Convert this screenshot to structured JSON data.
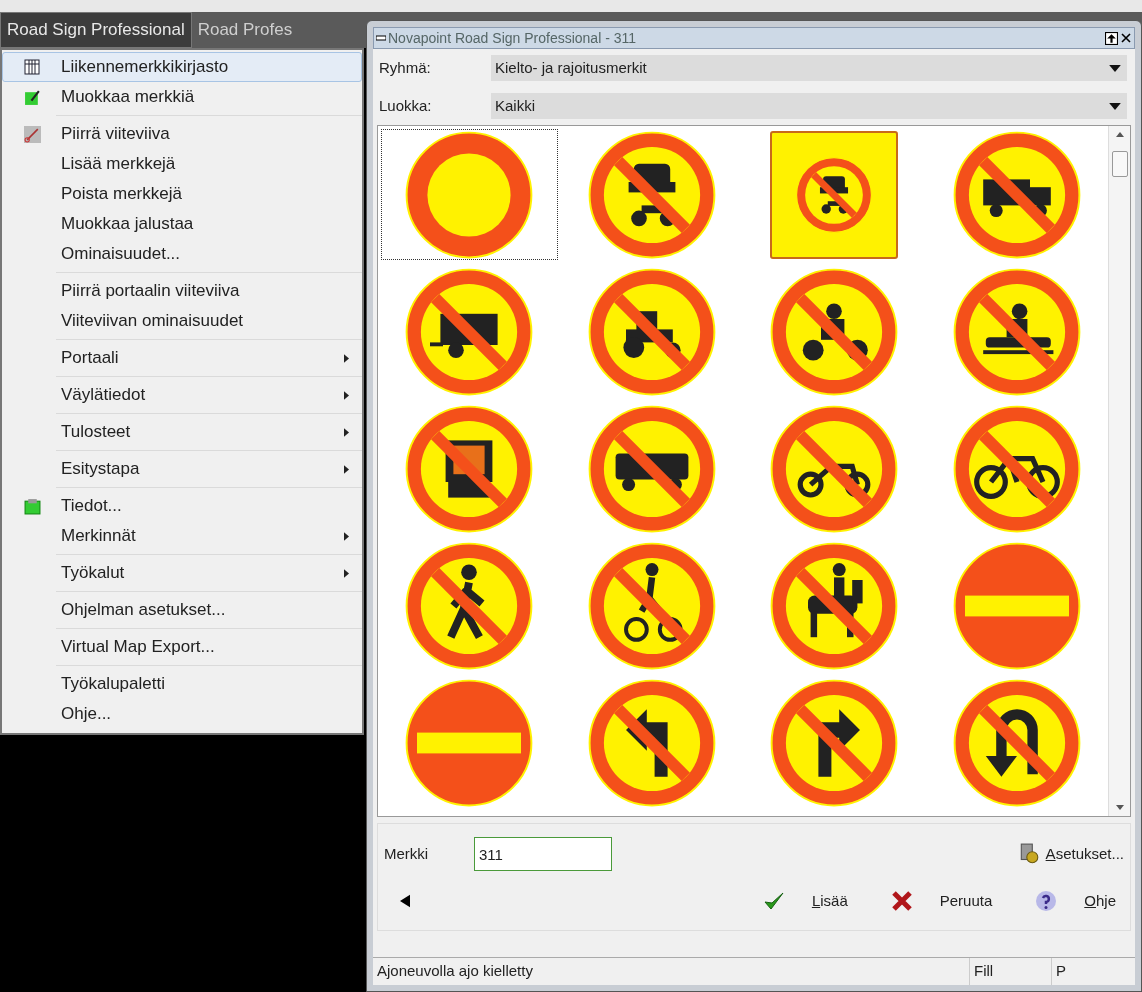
{
  "menu_bar": {
    "items": [
      {
        "label": "Road Sign Professional",
        "selected": true
      },
      {
        "label": "Road Profes",
        "selected": false
      }
    ]
  },
  "menu": {
    "groups": [
      [
        {
          "label": "Liikennemerkkikirjasto",
          "submenu": false,
          "highlighted": true
        },
        {
          "label": "Muokkaa merkkiä",
          "submenu": false,
          "highlighted": false
        }
      ],
      [
        {
          "label": "Piirrä viiteviiva",
          "submenu": false,
          "highlighted": false
        },
        {
          "label": "Lisää merkkejä",
          "submenu": false,
          "highlighted": false
        },
        {
          "label": "Poista merkkejä",
          "submenu": false,
          "highlighted": false
        },
        {
          "label": "Muokkaa jalustaa",
          "submenu": false,
          "highlighted": false
        },
        {
          "label": "Ominaisuudet...",
          "submenu": false,
          "highlighted": false
        }
      ],
      [
        {
          "label": "Piirrä portaalin viiteviiva",
          "submenu": false,
          "highlighted": false
        },
        {
          "label": "Viiteviivan ominaisuudet",
          "submenu": false,
          "highlighted": false
        }
      ],
      [
        {
          "label": "Portaali",
          "submenu": true,
          "highlighted": false
        }
      ],
      [
        {
          "label": "Väylätiedot",
          "submenu": true,
          "highlighted": false
        }
      ],
      [
        {
          "label": "Tulosteet",
          "submenu": true,
          "highlighted": false
        }
      ],
      [
        {
          "label": "Esitystapa",
          "submenu": true,
          "highlighted": false
        }
      ],
      [
        {
          "label": "Tiedot...",
          "submenu": false,
          "highlighted": false
        },
        {
          "label": "Merkinnät",
          "submenu": true,
          "highlighted": false
        }
      ],
      [
        {
          "label": "Työkalut",
          "submenu": true,
          "highlighted": false
        }
      ],
      [
        {
          "label": "Ohjelman asetukset...",
          "submenu": false,
          "highlighted": false
        }
      ],
      [
        {
          "label": "Virtual Map Export...",
          "submenu": false,
          "highlighted": false
        }
      ],
      [
        {
          "label": "Työkalupaletti",
          "submenu": false,
          "highlighted": false
        },
        {
          "label": "Ohje...",
          "submenu": false,
          "highlighted": false
        }
      ]
    ]
  },
  "dialog": {
    "title": "Novapoint Road Sign Professional - 311",
    "fields": [
      {
        "label": "Ryhmä:",
        "value": "Kielto- ja rajoitusmerkit"
      },
      {
        "label": "Luokka:",
        "value": "Kaikki"
      }
    ],
    "signs": [
      {
        "kind": "restriction",
        "selected": false,
        "focused": true
      },
      {
        "kind": "car-motorcycle",
        "selected": false,
        "focused": false
      },
      {
        "kind": "car-motorcycle",
        "selected": true,
        "focused": false
      },
      {
        "kind": "truck",
        "selected": false,
        "focused": false
      },
      {
        "kind": "trailer",
        "selected": false,
        "focused": false
      },
      {
        "kind": "tractor",
        "selected": false,
        "focused": false
      },
      {
        "kind": "motorcycle",
        "selected": false,
        "focused": false
      },
      {
        "kind": "snowmobile",
        "selected": false,
        "focused": false
      },
      {
        "kind": "hazard-vehicle",
        "selected": false,
        "focused": false
      },
      {
        "kind": "bus",
        "selected": false,
        "focused": false
      },
      {
        "kind": "moped",
        "selected": false,
        "focused": false
      },
      {
        "kind": "bicycle",
        "selected": false,
        "focused": false
      },
      {
        "kind": "pedestrian",
        "selected": false,
        "focused": false
      },
      {
        "kind": "pedestrian-bicycle",
        "selected": false,
        "focused": false
      },
      {
        "kind": "horse",
        "selected": false,
        "focused": false
      },
      {
        "kind": "no-entry",
        "selected": false,
        "focused": false
      },
      {
        "kind": "no-entry",
        "selected": false,
        "focused": false
      },
      {
        "kind": "left-turn",
        "selected": false,
        "focused": false
      },
      {
        "kind": "right-turn",
        "selected": false,
        "focused": false
      },
      {
        "kind": "u-turn",
        "selected": false,
        "focused": false
      }
    ],
    "sign_field": {
      "label": "Merkki",
      "value": "311"
    },
    "settings_button": "Asetukset...",
    "buttons": [
      {
        "kind": "ok",
        "label": "Lisää"
      },
      {
        "kind": "cancel",
        "label": "Peruuta"
      },
      {
        "kind": "help",
        "label": "Ohje"
      }
    ],
    "status_bar": [
      "Ajoneuvolla ajo kielletty",
      "Fill",
      "P"
    ]
  }
}
